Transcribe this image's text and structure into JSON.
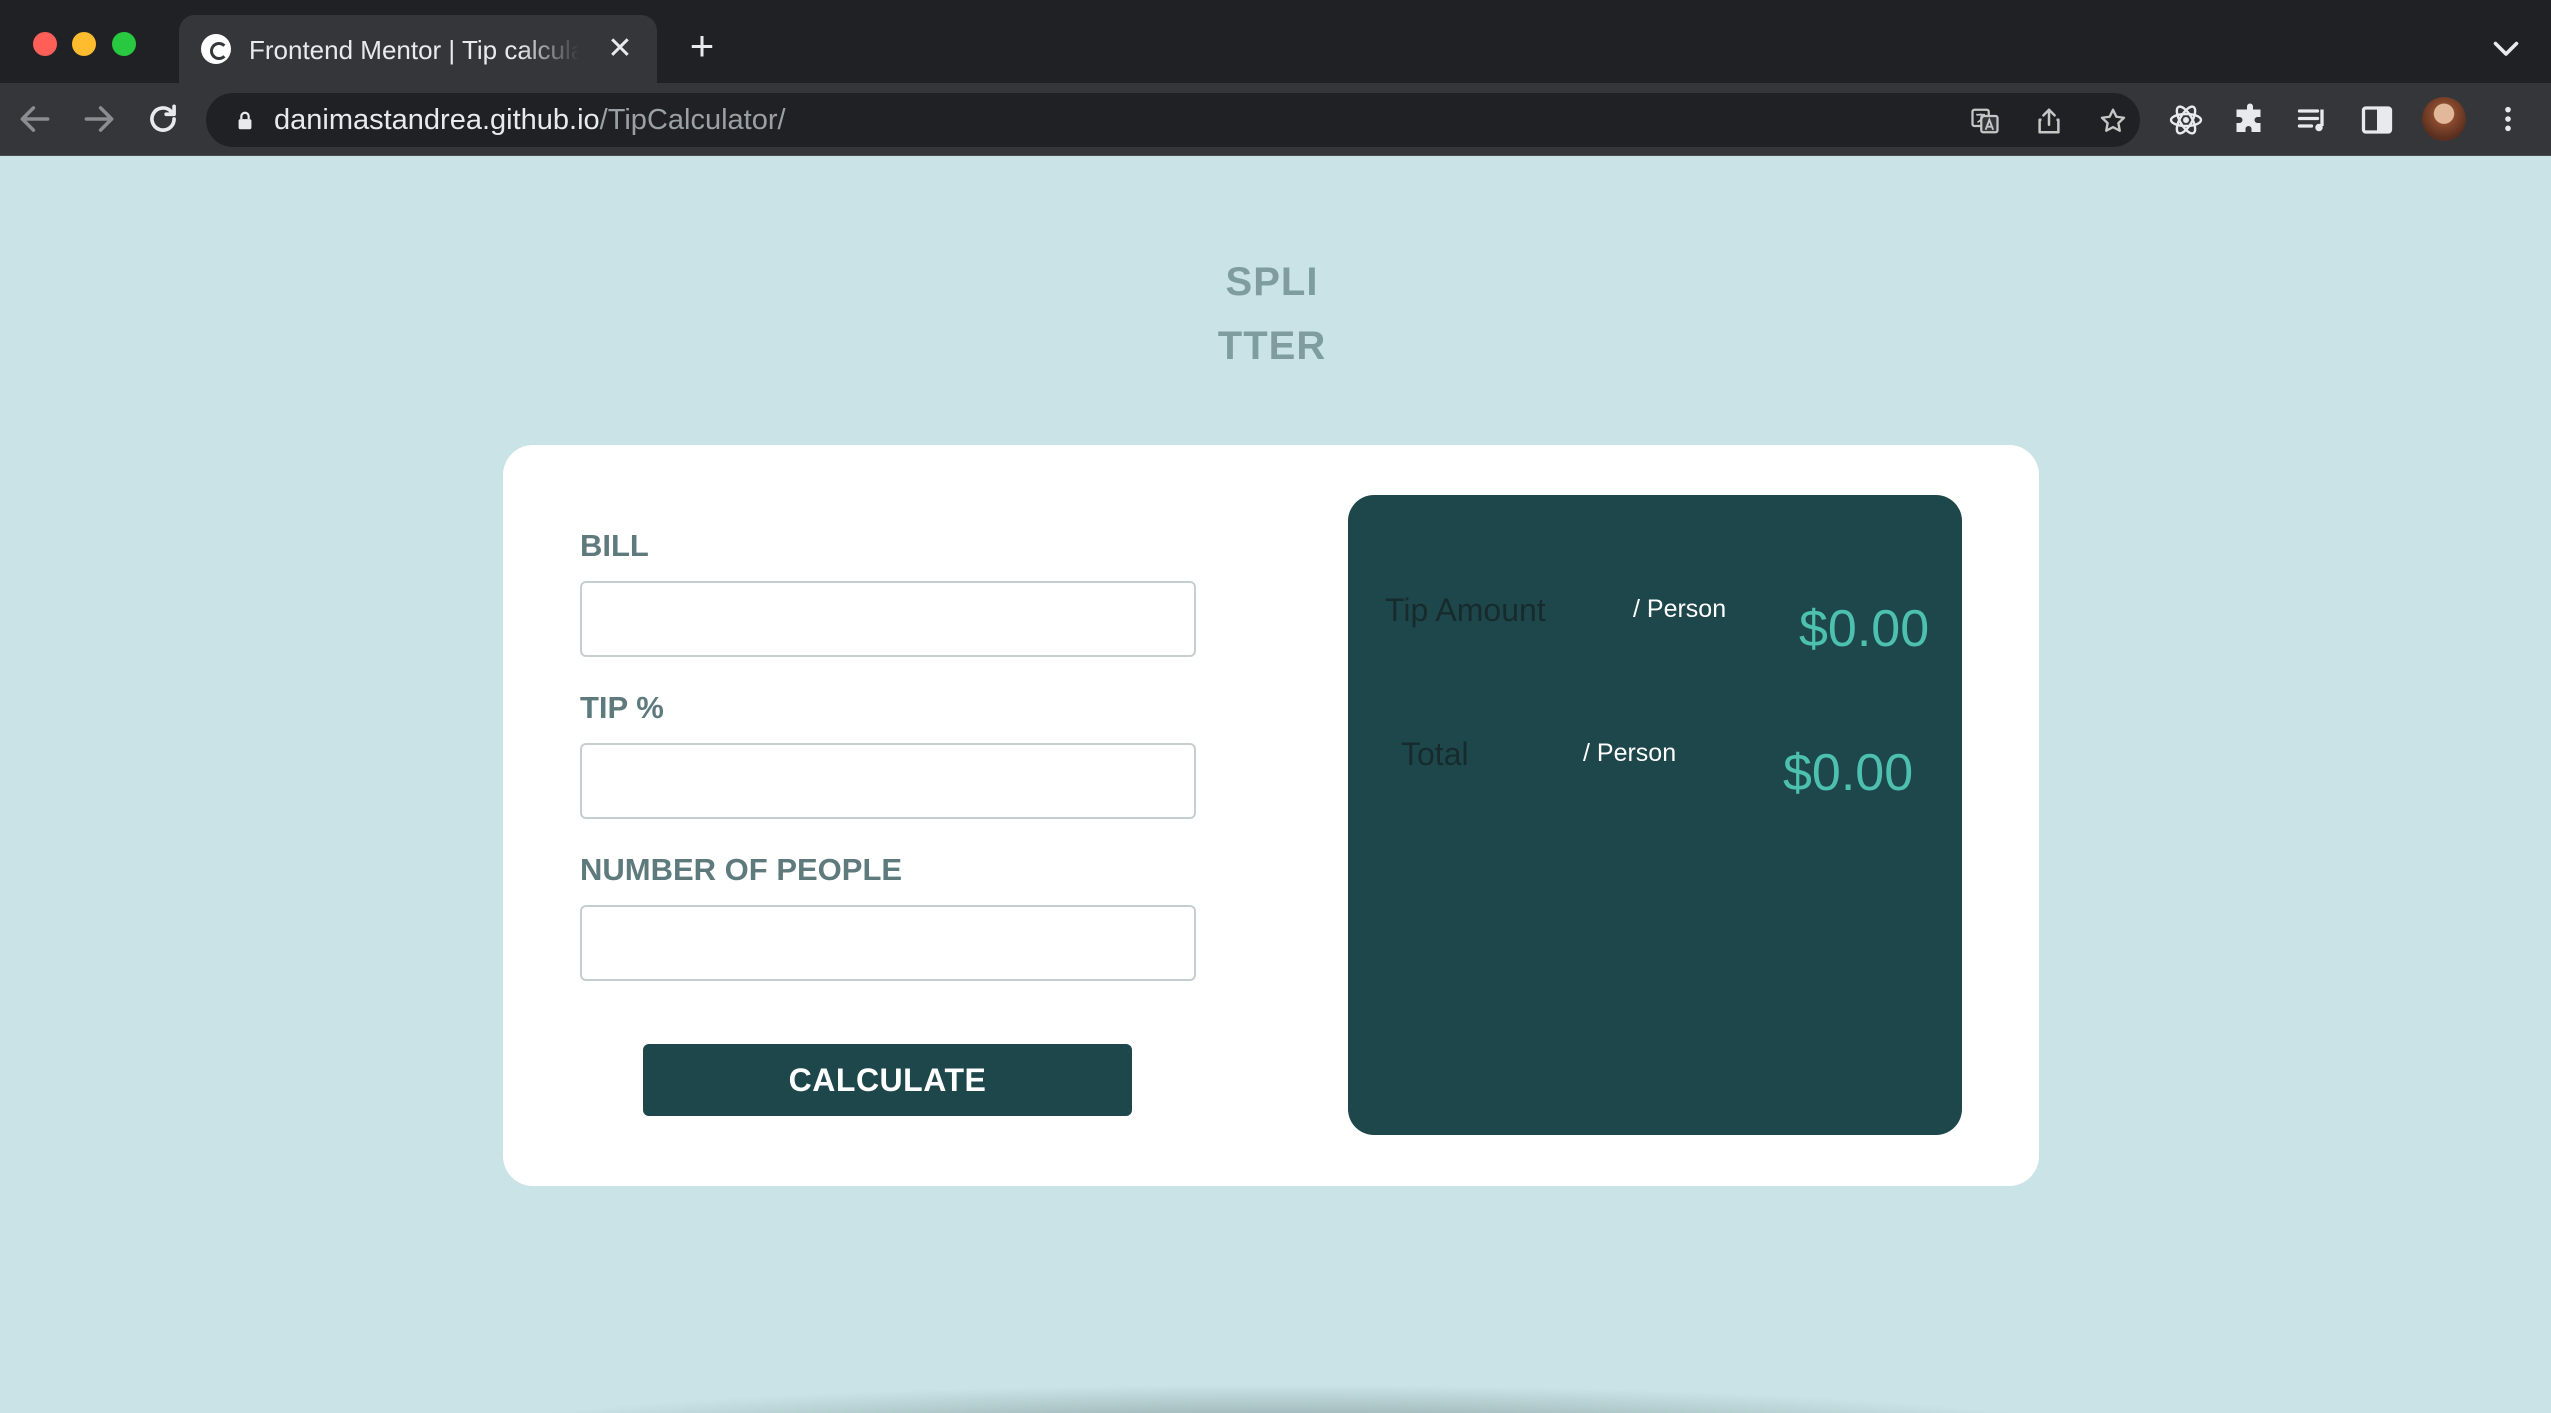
{
  "browser": {
    "tab": {
      "title": "Frontend Mentor | Tip calculator app",
      "favicon": "frontend-mentor-icon",
      "close_icon": "close-icon"
    },
    "new_tab_icon": "plus-icon",
    "tab_menu_icon": "chevron-down-icon",
    "nav": [
      "back-arrow-icon",
      "forward-arrow-icon",
      "reload-icon"
    ],
    "address": {
      "host": "danimastandrea.github.io",
      "path": "/TipCalculator/",
      "lock_icon": "lock-icon"
    },
    "omnibox_icons": [
      "translate-icon",
      "share-icon",
      "star-icon"
    ],
    "toolbar_icons": [
      "react-devtools-icon",
      "extensions-puzzle-icon",
      "reading-list-icon",
      "side-panel-icon",
      "profile-avatar",
      "more-menu-icon"
    ]
  },
  "page": {
    "logo": {
      "line1": "SPLI",
      "line2": "TTER"
    },
    "form": {
      "bill_label": "BILL",
      "tip_label": "TIP %",
      "people_label": "NUMBER OF PEOPLE",
      "bill_value": "",
      "tip_value": "",
      "people_value": "",
      "calculate_label": "CALCULATE"
    },
    "results": {
      "tip_label": "Tip Amount",
      "tip_sub": "/ Person",
      "tip_value": "$0.00",
      "total_label": "Total",
      "total_sub": "/ Person",
      "total_value": "$0.00"
    }
  },
  "colors": {
    "page_background": "#cae3e6",
    "card_background": "#ffffff",
    "panel_background": "#1d474b",
    "accent_value": "#4dc1ad",
    "button_background": "#1d474b",
    "label_text": "#5e7a7d",
    "logo_text": "#7f9d9f"
  }
}
